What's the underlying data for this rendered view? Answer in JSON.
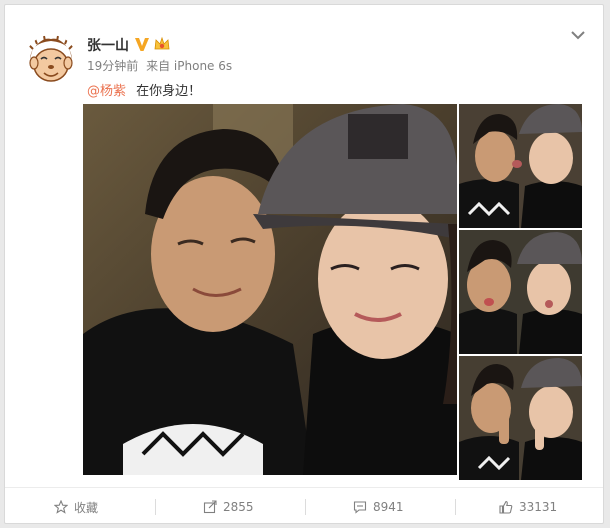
{
  "post": {
    "username": "张一山",
    "time": "19分钟前",
    "source": "来自 iPhone 6s",
    "mention": "@杨紫",
    "text": "在你身边！"
  },
  "actions": {
    "collect": "收藏",
    "repost": "2855",
    "comment": "8941",
    "like": "33131"
  },
  "icons": [
    "verified-v-icon",
    "vip-crown-icon",
    "chevron-down-icon",
    "star-icon",
    "repost-icon",
    "comment-icon",
    "like-icon"
  ],
  "colors": {
    "mention": "#eb7350",
    "verified": "#f5a623"
  }
}
